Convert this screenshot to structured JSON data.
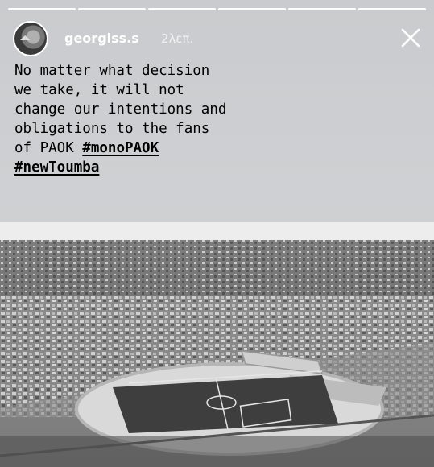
{
  "story": {
    "progress_segments": [
      {
        "state": "done"
      },
      {
        "state": "done"
      },
      {
        "state": "done"
      },
      {
        "state": "done"
      },
      {
        "state": "done"
      },
      {
        "state": "done"
      }
    ]
  },
  "header": {
    "username": "georgiss.s",
    "time_ago": "2λεπ.",
    "close_icon": "close-icon",
    "avatar_icon": "avatar"
  },
  "caption": {
    "line1": "No matter what decision",
    "line2": "we take, it will not",
    "line3": "change our intentions and",
    "line4": "obligations to the fans",
    "line5_prefix": "of PAOK ",
    "hashtag1": "#monoPAOK",
    "hashtag2": "#newToumba"
  },
  "photo": {
    "description_icon": "stadium-photo"
  },
  "colors": {
    "background": "#cdced1",
    "text": "#000000",
    "header_text": "#ffffff"
  }
}
